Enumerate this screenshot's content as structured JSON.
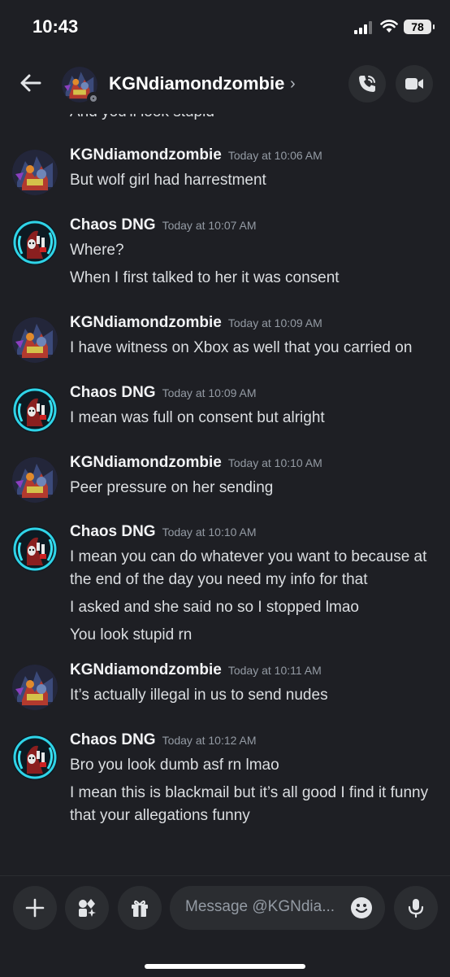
{
  "status_bar": {
    "time": "10:43",
    "battery": "78"
  },
  "header": {
    "name": "KGNdiamondzombie",
    "chevron": "›"
  },
  "chat": {
    "cut_text": "And you'll look stupid",
    "groups": [
      {
        "author": "KGNdiamondzombie",
        "timestamp": "Today at 10:06 AM",
        "avatar": "kgn",
        "lines": [
          "But wolf girl had harrestment"
        ]
      },
      {
        "author": "Chaos DNG",
        "timestamp": "Today at 10:07 AM",
        "avatar": "chaos",
        "lines": [
          "Where?",
          "When I first talked to her it was consent"
        ]
      },
      {
        "author": "KGNdiamondzombie",
        "timestamp": "Today at 10:09 AM",
        "avatar": "kgn",
        "lines": [
          "I have witness on Xbox as well that you carried on"
        ]
      },
      {
        "author": "Chaos DNG",
        "timestamp": "Today at 10:09 AM",
        "avatar": "chaos",
        "lines": [
          "I mean was full on consent but alright"
        ]
      },
      {
        "author": "KGNdiamondzombie",
        "timestamp": "Today at 10:10 AM",
        "avatar": "kgn",
        "lines": [
          "Peer pressure on her sending"
        ]
      },
      {
        "author": "Chaos DNG",
        "timestamp": "Today at 10:10 AM",
        "avatar": "chaos",
        "lines": [
          "I mean you can do whatever you want to because at the end of the day you need my info for that",
          "I asked and she said no so I stopped lmao",
          "You look stupid rn"
        ]
      },
      {
        "author": "KGNdiamondzombie",
        "timestamp": "Today at 10:11 AM",
        "avatar": "kgn",
        "lines": [
          "It’s actually illegal in us to send nudes"
        ]
      },
      {
        "author": "Chaos DNG",
        "timestamp": "Today at 10:12 AM",
        "avatar": "chaos",
        "lines": [
          "Bro you look dumb asf rn lmao",
          "I mean this is blackmail but it’s all good I find it funny that your allegations funny"
        ]
      }
    ]
  },
  "composer": {
    "placeholder": "Message @KGNdia..."
  }
}
